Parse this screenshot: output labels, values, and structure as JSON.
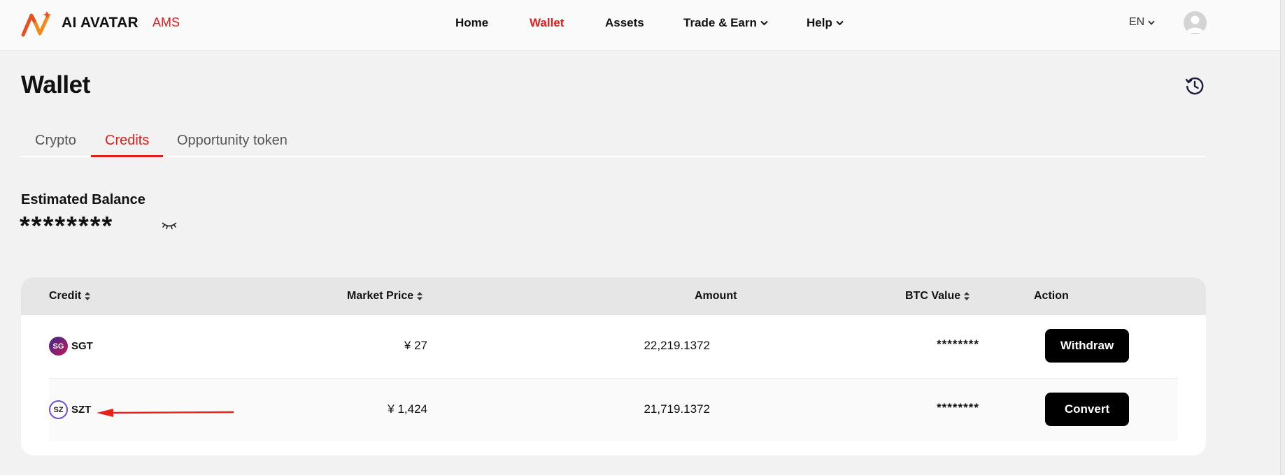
{
  "header": {
    "brand": "AI AVATAR",
    "brand_sub": "AMS",
    "nav": [
      {
        "label": "Home"
      },
      {
        "label": "Wallet"
      },
      {
        "label": "Assets"
      },
      {
        "label": "Trade & Earn"
      },
      {
        "label": "Help"
      }
    ],
    "language": "EN"
  },
  "page": {
    "title": "Wallet",
    "tabs": [
      {
        "label": "Crypto"
      },
      {
        "label": "Credits"
      },
      {
        "label": "Opportunity token"
      }
    ],
    "active_tab": "Credits"
  },
  "balance": {
    "label": "Estimated Balance",
    "value": "********"
  },
  "table": {
    "columns": [
      "Credit",
      "Market Price",
      "Amount",
      "BTC Value",
      "Action"
    ],
    "rows": [
      {
        "credit": "SGT",
        "icon_text": "SG",
        "price": "¥ 27",
        "amount": "22,219.1372",
        "btc": "********",
        "action": "Withdraw"
      },
      {
        "credit": "SZT",
        "icon_text": "SZ",
        "price": "¥ 1,424",
        "amount": "21,719.1372",
        "btc": "********",
        "action": "Convert"
      }
    ]
  },
  "colors": {
    "accent": "#e21b1b",
    "button": "#000000",
    "header_bg": "#fafafa",
    "page_bg": "#f2f2f2"
  },
  "icons": [
    "brand-logo-icon",
    "chevron-down-icon",
    "user-avatar-icon",
    "history-icon",
    "eye-closed-icon",
    "sort-icon",
    "sgt-coin-icon",
    "szt-coin-icon",
    "annotation-arrow-icon"
  ]
}
